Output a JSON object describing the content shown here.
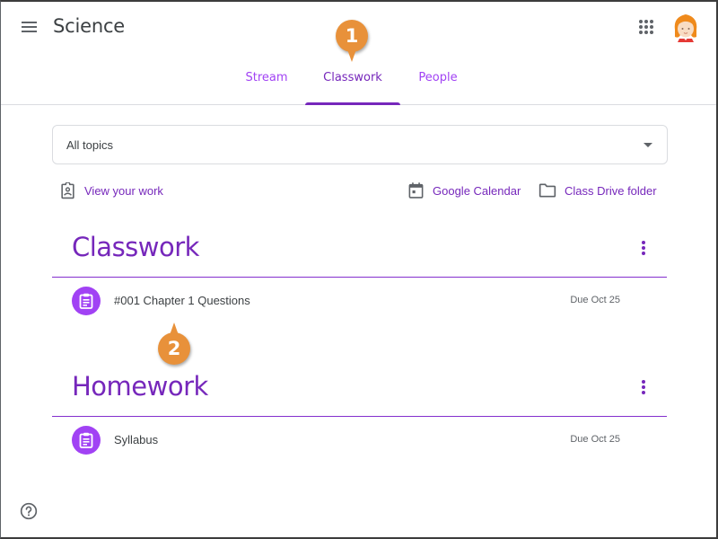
{
  "header": {
    "menu_icon": "hamburger-menu-icon",
    "class_title": "Science",
    "apps_icon": "google-apps-grid-icon",
    "avatar_icon": "user-avatar-girl"
  },
  "tabs": [
    {
      "label": "Stream",
      "active": false
    },
    {
      "label": "Classwork",
      "active": true
    },
    {
      "label": "People",
      "active": false
    }
  ],
  "callouts": [
    {
      "number": "1",
      "target": "Classwork tab"
    },
    {
      "number": "2",
      "target": "#001 Chapter 1 Questions"
    }
  ],
  "topic_filter": {
    "selected": "All topics"
  },
  "links": {
    "view_work": "View your work",
    "calendar": "Google Calendar",
    "drive_folder": "Class Drive folder"
  },
  "sections": [
    {
      "title": "Classwork",
      "items": [
        {
          "title": "#001 Chapter 1 Questions",
          "due": "Due Oct 25",
          "icon": "assignment-icon"
        }
      ]
    },
    {
      "title": "Homework",
      "items": [
        {
          "title": "Syllabus",
          "due": "Due Oct 25",
          "icon": "assignment-icon"
        }
      ]
    }
  ],
  "help": {
    "icon": "help-circle-icon"
  },
  "colors": {
    "accent": "#7627bb",
    "accent_light": "#a142f4",
    "callout": "#e8913a",
    "text": "#3c4043",
    "muted": "#5f6368",
    "divider": "#dadce0"
  }
}
